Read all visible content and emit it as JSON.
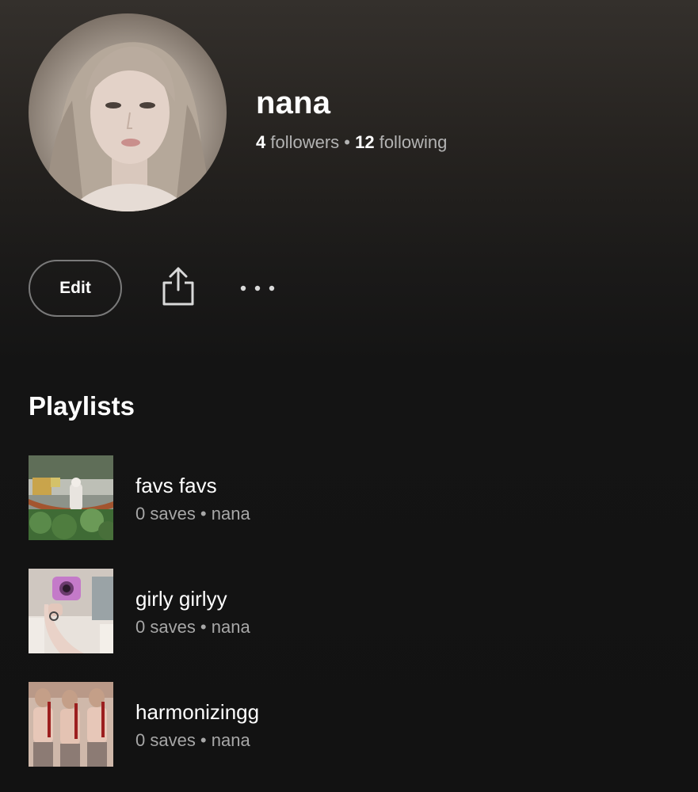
{
  "profile": {
    "username": "nana",
    "followers_count": "4",
    "followers_label": " followers",
    "separator": " • ",
    "following_count": "12",
    "following_label": " following"
  },
  "actions": {
    "edit_label": "Edit",
    "share_icon": "share-icon",
    "more_icon": "more-options-icon"
  },
  "playlists_section": {
    "title": "Playlists",
    "items": [
      {
        "name": "favs favs",
        "meta": "0 saves • nana"
      },
      {
        "name": "girly girlyy",
        "meta": "0 saves • nana"
      },
      {
        "name": "harmonizingg",
        "meta": "0 saves • nana"
      }
    ]
  },
  "colors": {
    "background_top": "#34302c",
    "background_bottom": "#121212",
    "text_primary": "#ffffff",
    "text_secondary": "#b3b3b3",
    "button_border": "#7a7a7a"
  }
}
